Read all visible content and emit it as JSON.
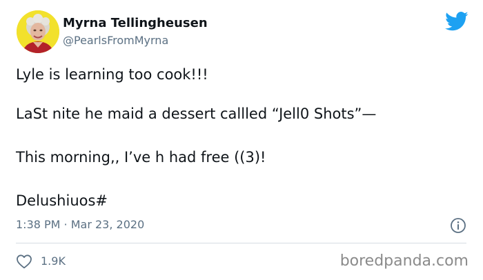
{
  "author": {
    "display_name": "Myrna Tellingheusen",
    "handle": "@PearlsFromMyrna",
    "avatar_icon": "avatar-photo",
    "avatar_bg": "#f2e12c"
  },
  "tweet": {
    "lines": [
      "Lyle is learning too cook!!!",
      "LaSt nite he maid a dessert callled “Jell0 Shots”—",
      "This morning,, I’ve h had free ((3)!",
      "Delushiuos#"
    ],
    "timestamp": "1:38 PM · Mar 23, 2020"
  },
  "engagement": {
    "like_icon": "heart-icon",
    "like_count": "1.9K",
    "info_icon": "info-icon"
  },
  "brand": {
    "logo_icon": "twitter-bird-icon",
    "accent": "#1da1f2"
  },
  "watermark": "boredpanda.com"
}
